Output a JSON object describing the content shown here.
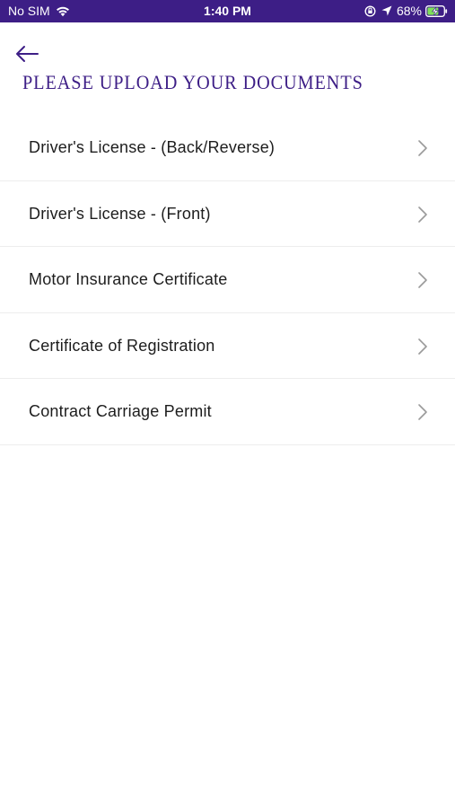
{
  "status_bar": {
    "carrier": "No SIM",
    "time": "1:40 PM",
    "battery_percent": "68%",
    "background_color": "#3d1e86",
    "icons": [
      "wifi-icon",
      "orientation-lock-icon",
      "location-arrow-icon",
      "battery-charging-icon"
    ]
  },
  "header": {
    "back_icon": "arrow-left-icon",
    "title": "PLEASE UPLOAD YOUR DOCUMENTS",
    "accent_color": "#3d1e86"
  },
  "documents": [
    {
      "label": "Driver's License - (Back/Reverse)"
    },
    {
      "label": "Driver's License - (Front)"
    },
    {
      "label": "Motor Insurance Certificate"
    },
    {
      "label": "Certificate of Registration"
    },
    {
      "label": "Contract Carriage Permit"
    }
  ],
  "row_icon": "chevron-right-icon"
}
